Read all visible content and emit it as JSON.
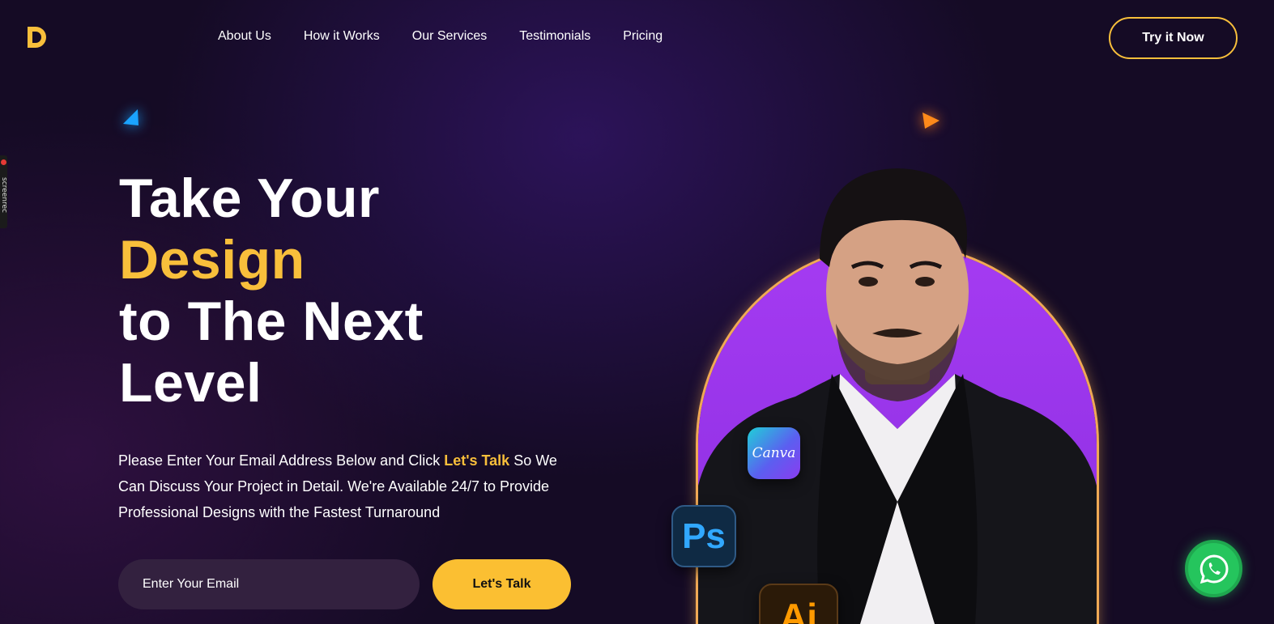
{
  "brand": {
    "logo_letter": "D",
    "accent_color": "#f8bf3b"
  },
  "nav": {
    "items": [
      {
        "label": "About Us"
      },
      {
        "label": "How it Works"
      },
      {
        "label": "Our Services"
      },
      {
        "label": "Testimonials"
      },
      {
        "label": "Pricing"
      }
    ],
    "cta_label": "Try it Now"
  },
  "recorder_tab": {
    "label": "screenrec"
  },
  "hero": {
    "headline": {
      "line1": "Take Your",
      "line2": "Design",
      "line3": "to The Next",
      "line4": "Level"
    },
    "description": {
      "before": "Please Enter Your Email Address Below and Click ",
      "highlight": "Let's Talk",
      "after": " So We Can Discuss Your Project in Detail. We're Available 24/7 to Provide Professional Designs with the Fastest Turnaround"
    },
    "email_placeholder": "Enter Your Email",
    "submit_label": "Let's Talk"
  },
  "visual": {
    "arch_color": "#a53bf2",
    "badges": {
      "canva": "Canva",
      "photoshop": "Ps",
      "illustrator": "Ai"
    }
  },
  "floating": {
    "whatsapp_icon": "whatsapp-icon"
  }
}
